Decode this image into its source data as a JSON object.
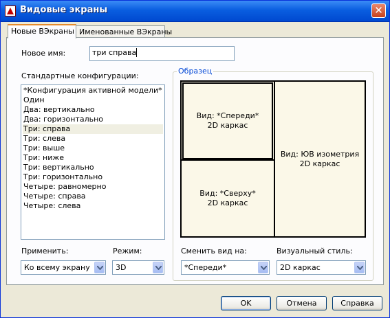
{
  "window": {
    "title": "Видовые экраны"
  },
  "tabs": [
    {
      "label": "Новые ВЭкраны"
    },
    {
      "label": "Именованные ВЭкраны"
    }
  ],
  "new_name": {
    "label": "Новое имя:",
    "value": "три справа"
  },
  "standard_configs": {
    "label": "Стандартные конфигурации:",
    "items": [
      "*Конфигурация активной модели*",
      "Один",
      "Два: вертикально",
      "Два: горизонтально",
      "Три: справа",
      "Три: слева",
      "Три: выше",
      "Три: ниже",
      "Три: вертикально",
      "Три: горизонтально",
      "Четыре: равномерно",
      "Четыре: справа",
      "Четыре: слева"
    ],
    "selected": "Три: справа"
  },
  "sample": {
    "caption": "Образец",
    "viewports": {
      "top_left": {
        "line1": "Вид: *Спереди*",
        "line2": "2D каркас"
      },
      "bottom_left": {
        "line1": "Вид: *Сверху*",
        "line2": "2D каркас"
      },
      "right": {
        "line1": "Вид: ЮВ изометрия",
        "line2": "2D каркас"
      }
    }
  },
  "apply": {
    "label": "Применить:",
    "value": "Ко всему экрану"
  },
  "mode": {
    "label": "Режим:",
    "value": "3D"
  },
  "change_view": {
    "label": "Сменить вид на:",
    "value": "*Спереди*"
  },
  "visual_style": {
    "label": "Визуальный стиль:",
    "value": "2D каркас"
  },
  "buttons": {
    "ok": "OK",
    "cancel": "Отмена",
    "help": "Справка"
  }
}
